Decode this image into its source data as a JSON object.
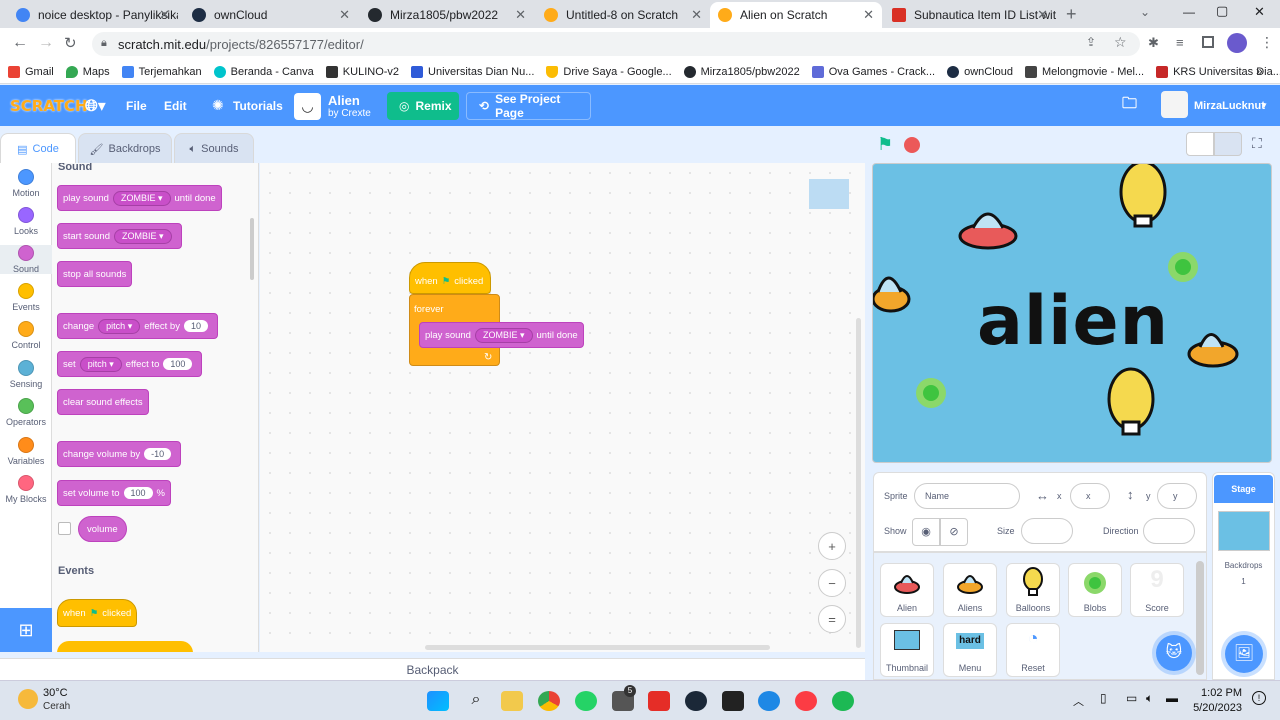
{
  "browser": {
    "tabs": [
      {
        "label": "noice desktop - Panyliksikan",
        "color": "#4285f4"
      },
      {
        "label": "ownCloud",
        "color": "#1d2d44"
      },
      {
        "label": "Mirza1805/pbw2022",
        "color": "#24292f"
      },
      {
        "label": "Untitled-8 on Scratch",
        "color": "#ffab19"
      },
      {
        "label": "Alien on Scratch",
        "color": "#ffab19"
      },
      {
        "label": "Subnautica Item ID List wit",
        "color": "#d93025"
      }
    ],
    "url_domain": "scratch.mit.edu",
    "url_path": "/projects/826557177/editor/",
    "bookmarks": [
      "Gmail",
      "Maps",
      "Terjemahkan",
      "Beranda - Canva",
      "KULINO-v2",
      "Universitas Dian Nu...",
      "Drive Saya - Google...",
      "Mirza1805/pbw2022",
      "Ova Games - Crack...",
      "ownCloud",
      "Melongmovie - Mel...",
      "KRS Universitas Dia..."
    ]
  },
  "menubar": {
    "logo": "SCRATCH",
    "file": "File",
    "edit": "Edit",
    "tutorials": "Tutorials",
    "project_title": "Alien",
    "author": "by Crexte",
    "remix": "Remix",
    "see_project": "See Project Page",
    "username": "MirzaLucknut"
  },
  "editor_tabs": {
    "code": "Code",
    "backdrops": "Backdrops",
    "sounds": "Sounds"
  },
  "categories": [
    {
      "label": "Motion",
      "color": "#4c97ff"
    },
    {
      "label": "Looks",
      "color": "#9966ff"
    },
    {
      "label": "Sound",
      "color": "#cf63cf"
    },
    {
      "label": "Events",
      "color": "#ffbf00"
    },
    {
      "label": "Control",
      "color": "#ffab19"
    },
    {
      "label": "Sensing",
      "color": "#5cb1d6"
    },
    {
      "label": "Operators",
      "color": "#59c059"
    },
    {
      "label": "Variables",
      "color": "#ff8c1a"
    },
    {
      "label": "My Blocks",
      "color": "#ff6680"
    }
  ],
  "palette": {
    "sound_header": "Sound",
    "events_header": "Events",
    "play_sound": "play sound",
    "start_sound": "start sound",
    "until_done": "until done",
    "zombie": "ZOMBIE",
    "stop_all": "stop all sounds",
    "change": "change",
    "set": "set",
    "pitch": "pitch",
    "effect_by": "effect by",
    "effect_to": "effect to",
    "val_10": "10",
    "val_100": "100",
    "clear_effects": "clear sound effects",
    "change_volume": "change volume by",
    "val_neg10": "-10",
    "set_volume": "set volume to",
    "percent": "%",
    "volume": "volume",
    "when": "when",
    "clicked": "clicked"
  },
  "script": {
    "when": "when",
    "clicked": "clicked",
    "forever": "forever",
    "play_sound": "play sound",
    "zombie": "ZOMBIE",
    "until_done": "until done"
  },
  "zoom": {
    "in": "+",
    "out": "−",
    "reset": "="
  },
  "backpack": "Backpack",
  "stage": {
    "title_text": "alien"
  },
  "sprite_info": {
    "sprite_label": "Sprite",
    "name_placeholder": "Name",
    "x_label": "x",
    "x_placeholder": "x",
    "y_label": "y",
    "y_placeholder": "y",
    "show_label": "Show",
    "size_label": "Size",
    "direction_label": "Direction"
  },
  "sprites": [
    "Alien",
    "Aliens",
    "Balloons",
    "Blobs",
    "Score",
    "Thumbnail",
    "Menu",
    "Reset"
  ],
  "menu_thumb_text": "hard",
  "score_thumb_text": "9",
  "stage_panel": {
    "title": "Stage",
    "backdrops_label": "Backdrops",
    "backdrops_count": "1"
  },
  "taskbar": {
    "temp": "30°C",
    "weather": "Cerah",
    "time": "1:02 PM",
    "date": "5/20/2023",
    "badge": "5"
  }
}
